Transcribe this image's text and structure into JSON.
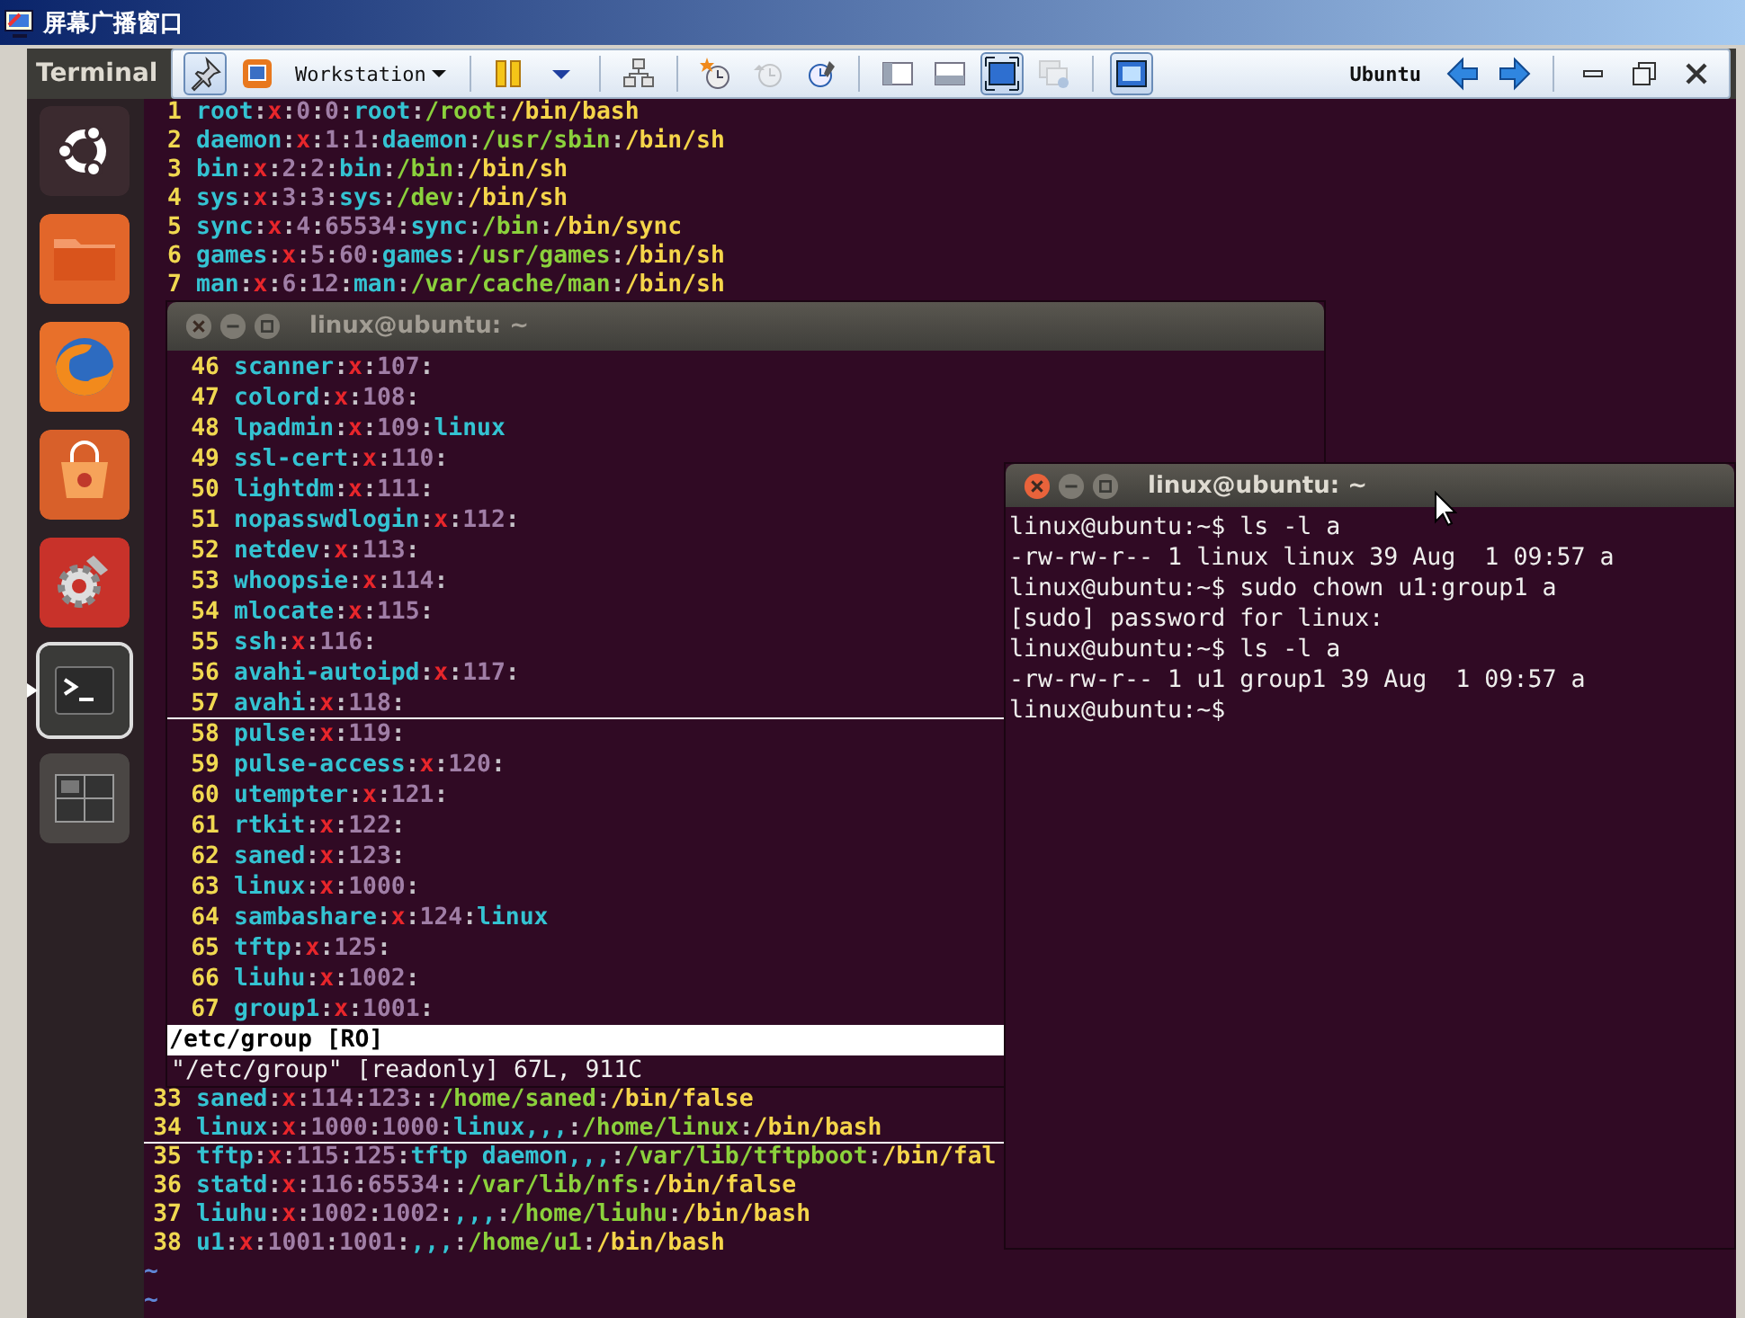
{
  "window": {
    "title": "屏幕广播窗口"
  },
  "panel": {
    "app_title": "Terminal"
  },
  "toolbar": {
    "items_left": [
      {
        "kind": "pin",
        "pressed": true,
        "disabled": false
      },
      {
        "kind": "vm",
        "pressed": false,
        "disabled": false
      },
      {
        "kind": "menu",
        "label": "Workstation"
      },
      {
        "kind": "separator"
      },
      {
        "kind": "pause",
        "pressed": false,
        "disabled": false
      },
      {
        "kind": "caret",
        "pressed": false,
        "disabled": false
      },
      {
        "kind": "separator"
      },
      {
        "kind": "network",
        "pressed": false,
        "disabled": false
      },
      {
        "kind": "separator"
      },
      {
        "kind": "snapshot",
        "pressed": false,
        "disabled": false
      },
      {
        "kind": "revert",
        "pressed": false,
        "disabled": true
      },
      {
        "kind": "manager",
        "pressed": false,
        "disabled": false
      },
      {
        "kind": "separator"
      },
      {
        "kind": "sidebar",
        "pressed": false,
        "disabled": false
      },
      {
        "kind": "tabs",
        "pressed": false,
        "disabled": false
      },
      {
        "kind": "fullscreen",
        "pressed": true,
        "disabled": false
      },
      {
        "kind": "unity",
        "pressed": false,
        "disabled": true
      },
      {
        "kind": "separator"
      },
      {
        "kind": "console",
        "pressed": true,
        "disabled": false
      }
    ],
    "items_right": [
      {
        "kind": "label",
        "label": "Ubuntu"
      },
      {
        "kind": "back",
        "pressed": false,
        "disabled": false
      },
      {
        "kind": "forward",
        "pressed": false,
        "disabled": false
      },
      {
        "kind": "separator"
      },
      {
        "kind": "minimize",
        "pressed": false,
        "disabled": false
      },
      {
        "kind": "restore",
        "pressed": false,
        "disabled": false
      },
      {
        "kind": "close",
        "pressed": false,
        "disabled": false
      }
    ]
  },
  "launcher": [
    {
      "kind": "ubuntu",
      "active": false
    },
    {
      "kind": "files",
      "active": false
    },
    {
      "kind": "browser",
      "active": false
    },
    {
      "kind": "software",
      "active": false
    },
    {
      "kind": "settings",
      "active": false
    },
    {
      "kind": "terminal",
      "active": true
    },
    {
      "kind": "workspaces",
      "active": false
    }
  ],
  "background_editor": {
    "kind": "passwd",
    "lines_top": [
      {
        "n": "1",
        "text": "root:x:0:0:root:/root:/bin/bash",
        "current": false
      },
      {
        "n": "2",
        "text": "daemon:x:1:1:daemon:/usr/sbin:/bin/sh",
        "current": false
      },
      {
        "n": "3",
        "text": "bin:x:2:2:bin:/bin:/bin/sh",
        "current": false
      },
      {
        "n": "4",
        "text": "sys:x:3:3:sys:/dev:/bin/sh",
        "current": false
      },
      {
        "n": "5",
        "text": "sync:x:4:65534:sync:/bin:/bin/sync",
        "current": false
      },
      {
        "n": "6",
        "text": "games:x:5:60:games:/usr/games:/bin/sh",
        "current": false
      },
      {
        "n": "7",
        "text": "man:x:6:12:man:/var/cache/man:/bin/sh",
        "current": false
      }
    ],
    "lines_bottom": [
      {
        "n": "33",
        "text": "saned:x:114:123::/home/saned:/bin/false",
        "current": false
      },
      {
        "n": "34",
        "text": "linux:x:1000:1000:linux,,,:/home/linux:/bin/bash",
        "current": true
      },
      {
        "n": "35",
        "text": "tftp:x:115:125:tftp daemon,,,:/var/lib/tftpboot:/bin/fal",
        "current": false
      },
      {
        "n": "36",
        "text": "statd:x:116:65534::/var/lib/nfs:/bin/false",
        "current": false
      },
      {
        "n": "37",
        "text": "liuhu:x:1002:1002:,,,:/home/liuhu:/bin/bash",
        "current": false
      },
      {
        "n": "38",
        "text": "u1:x:1001:1001:,,,:/home/u1:/bin/bash",
        "current": false
      }
    ],
    "tildes": [
      "~",
      "~"
    ]
  },
  "editor_window": {
    "title": "linux@ubuntu: ~",
    "focused": false,
    "kind": "group",
    "lines": [
      {
        "n": "46",
        "text": "scanner:x:107:",
        "current": false
      },
      {
        "n": "47",
        "text": "colord:x:108:",
        "current": false
      },
      {
        "n": "48",
        "text": "lpadmin:x:109:linux",
        "current": false
      },
      {
        "n": "49",
        "text": "ssl-cert:x:110:",
        "current": false
      },
      {
        "n": "50",
        "text": "lightdm:x:111:",
        "current": false
      },
      {
        "n": "51",
        "text": "nopasswdlogin:x:112:",
        "current": false
      },
      {
        "n": "52",
        "text": "netdev:x:113:",
        "current": false
      },
      {
        "n": "53",
        "text": "whoopsie:x:114:",
        "current": false
      },
      {
        "n": "54",
        "text": "mlocate:x:115:",
        "current": false
      },
      {
        "n": "55",
        "text": "ssh:x:116:",
        "current": false
      },
      {
        "n": "56",
        "text": "avahi-autoipd:x:117:",
        "current": false
      },
      {
        "n": "57",
        "text": "avahi:x:118:",
        "current": true
      },
      {
        "n": "58",
        "text": "pulse:x:119:",
        "current": false
      },
      {
        "n": "59",
        "text": "pulse-access:x:120:",
        "current": false
      },
      {
        "n": "60",
        "text": "utempter:x:121:",
        "current": false
      },
      {
        "n": "61",
        "text": "rtkit:x:122:",
        "current": false
      },
      {
        "n": "62",
        "text": "saned:x:123:",
        "current": false
      },
      {
        "n": "63",
        "text": "linux:x:1000:",
        "current": false
      },
      {
        "n": "64",
        "text": "sambashare:x:124:linux",
        "current": false
      },
      {
        "n": "65",
        "text": "tftp:x:125:",
        "current": false
      },
      {
        "n": "66",
        "text": "liuhu:x:1002:",
        "current": false
      },
      {
        "n": "67",
        "text": "group1:x:1001:",
        "current": false
      }
    ],
    "status_line": "/etc/group [RO]",
    "message": "\"/etc/group\" [readonly] 67L, 911C"
  },
  "terminal_window": {
    "title": "linux@ubuntu: ~",
    "focused": true,
    "lines": [
      "linux@ubuntu:~$ ls -l a",
      "-rw-rw-r-- 1 linux linux 39 Aug  1 09:57 a",
      "linux@ubuntu:~$ sudo chown u1:group1 a",
      "[sudo] password for linux:",
      "linux@ubuntu:~$ ls -l a",
      "-rw-rw-r-- 1 u1 group1 39 Aug  1 09:57 a",
      "linux@ubuntu:~$"
    ]
  }
}
